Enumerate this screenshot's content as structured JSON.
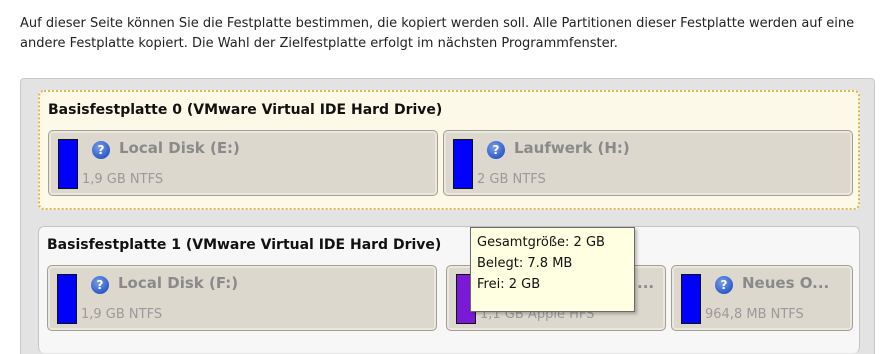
{
  "intro_text": "Auf dieser Seite können Sie die Festplatte bestimmen, die kopiert werden soll. Alle Partitionen dieser Festplatte werden auf eine andere Festplatte kopiert. Die Wahl der Zielfestplatte erfolgt im nächsten Programmfenster.",
  "disks": [
    {
      "title": "Basisfestplatte 0 (VMware Virtual IDE Hard Drive)",
      "partitions": [
        {
          "name": "Local Disk (E:)",
          "info": "1,9 GB NTFS",
          "color": "#0000ff",
          "icon": "help-icon"
        },
        {
          "name": "Laufwerk (H:)",
          "info": "2 GB NTFS",
          "color": "#0000ff",
          "icon": "help-icon"
        }
      ]
    },
    {
      "title": "Basisfestplatte 1 (VMware Virtual IDE Hard Drive)",
      "partitions": [
        {
          "name": "Local Disk (F:)",
          "info": "1,9 GB NTFS",
          "color": "#0000ff",
          "icon": "help-icon"
        },
        {
          "name": "...",
          "info": "1,1 GB Apple HFS",
          "color": "#7b19d9",
          "icon": ""
        },
        {
          "name": "Neues O...",
          "info": "964,8 MB NTFS",
          "color": "#0000ff",
          "icon": "help-icon"
        }
      ]
    }
  ],
  "tooltip": {
    "total": "Gesamtgröße: 2 GB",
    "used": "Belegt: 7.8 MB",
    "free": "Frei: 2 GB"
  },
  "colors": {
    "selected_border": "#d9b557",
    "partition_bg": "#dcd8ce",
    "tooltip_bg": "#ffffe1"
  }
}
